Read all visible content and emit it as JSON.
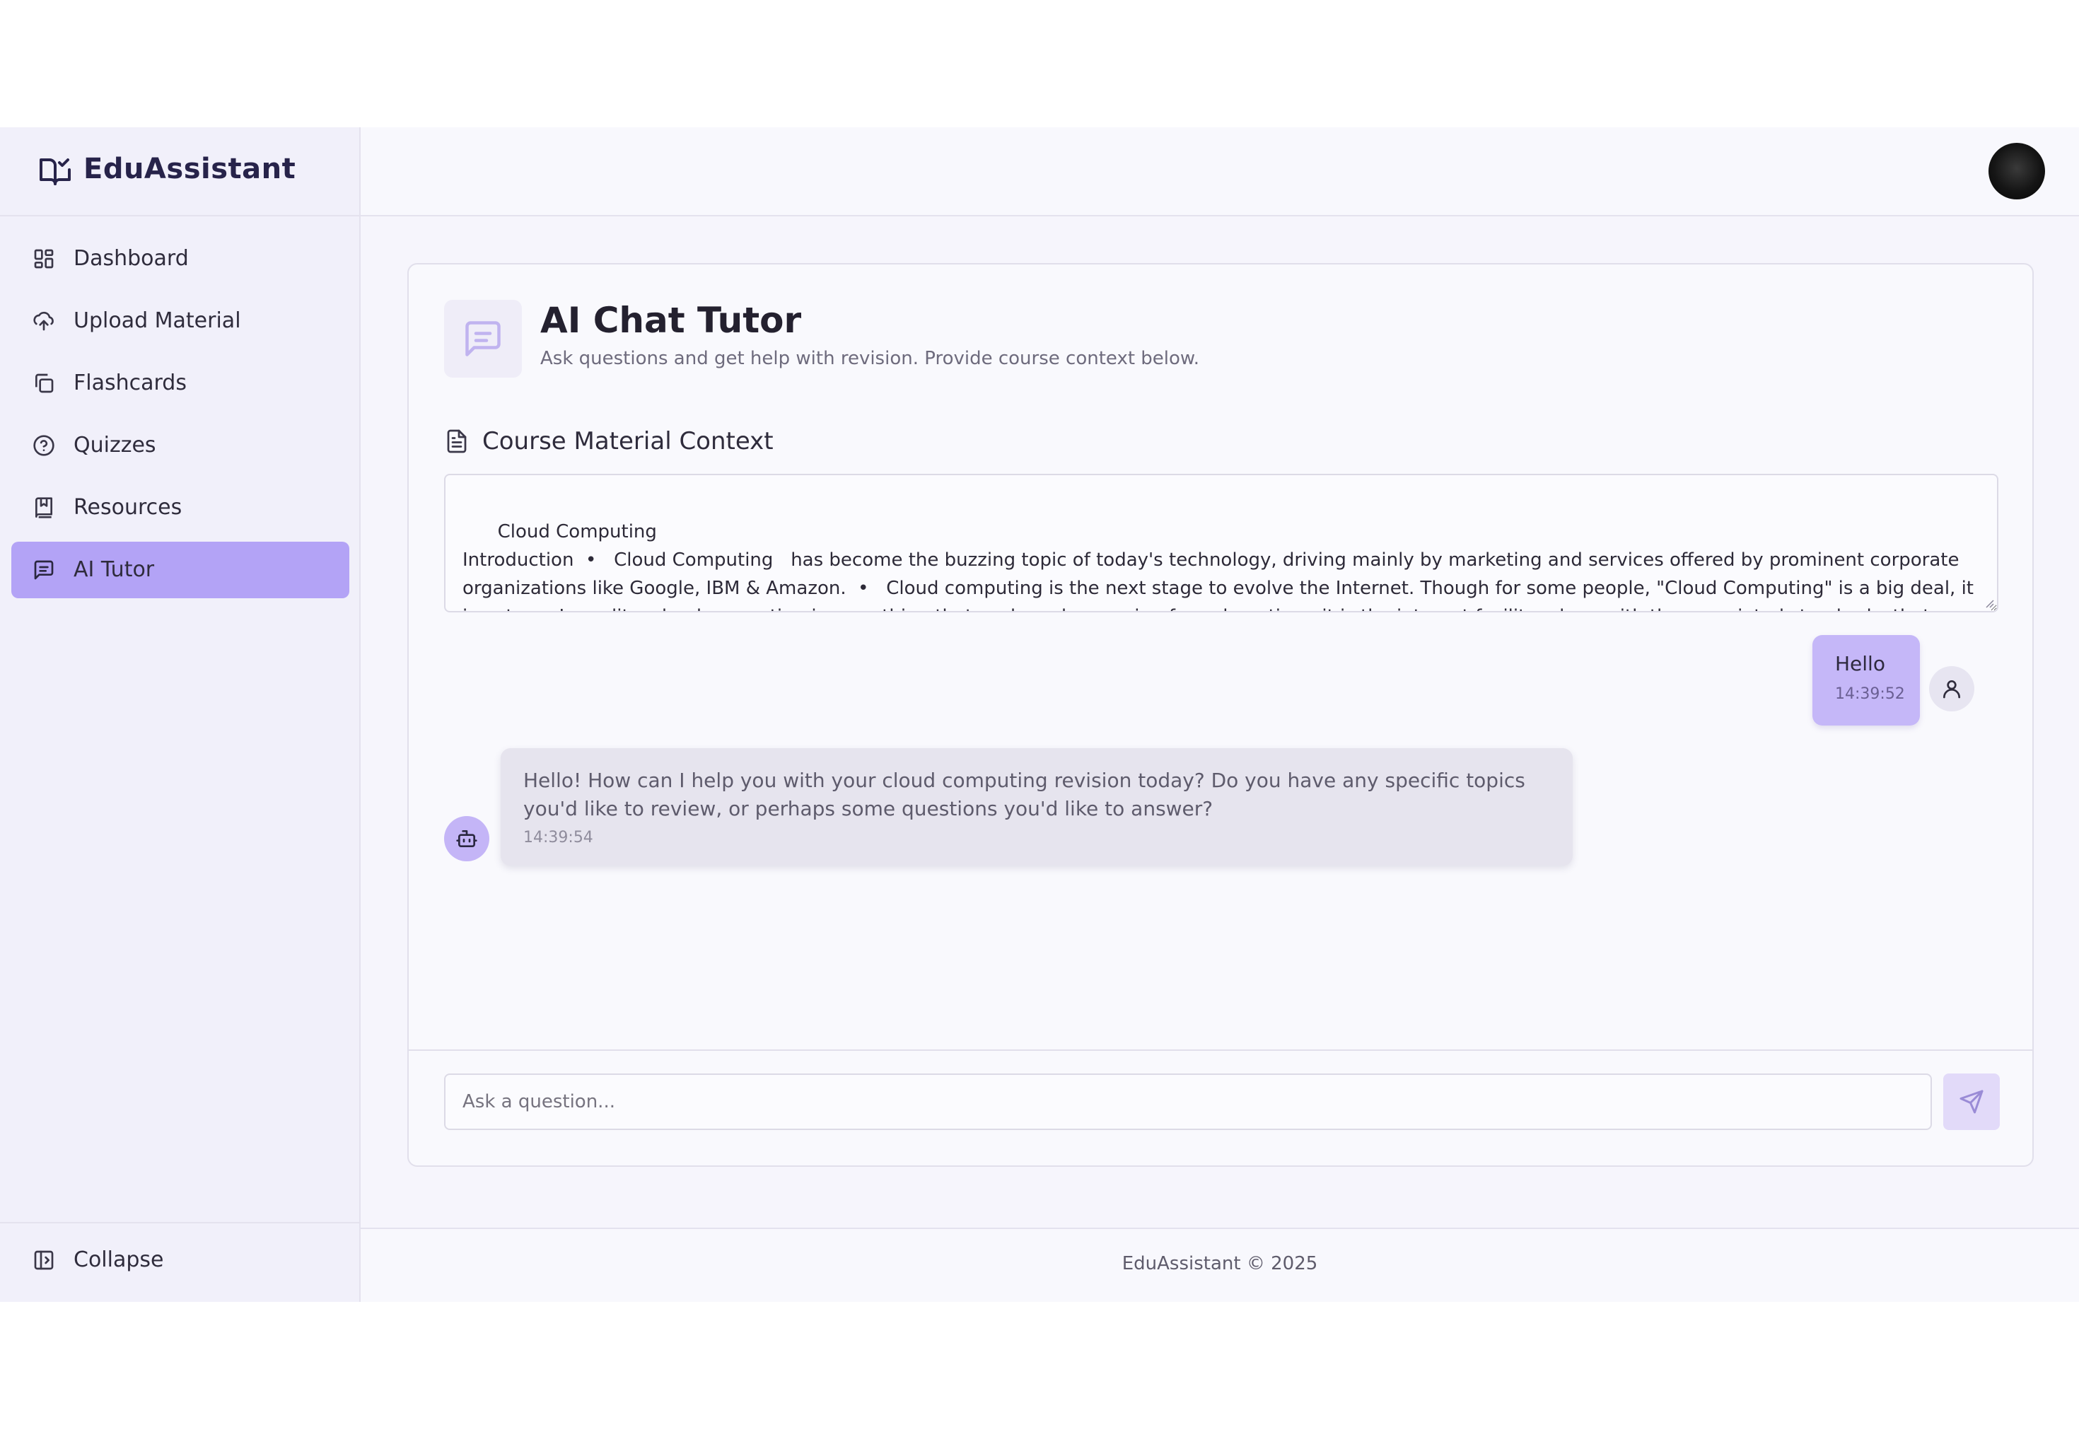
{
  "app": {
    "name": "EduAssistant"
  },
  "sidebar": {
    "items": [
      {
        "label": "Dashboard",
        "icon": "dashboard-icon"
      },
      {
        "label": "Upload Material",
        "icon": "upload-cloud-icon"
      },
      {
        "label": "Flashcards",
        "icon": "copy-icon"
      },
      {
        "label": "Quizzes",
        "icon": "help-circle-icon"
      },
      {
        "label": "Resources",
        "icon": "bookmark-book-icon"
      },
      {
        "label": "AI Tutor",
        "icon": "chat-icon",
        "active": true
      }
    ],
    "collapse_label": "Collapse"
  },
  "page": {
    "title": "AI Chat Tutor",
    "subtitle": "Ask questions and get help with revision. Provide course context below."
  },
  "context": {
    "label": "Course Material Context",
    "value": "Cloud Computing\nIntroduction  •   Cloud Computing   has become the buzzing topic of today's technology, driving mainly by marketing and services offered by prominent corporate  organizations like Google, IBM & Amazon.  •   Cloud computing is the next stage to evolve the Internet. Though for some people, \"Cloud Computing\" is a big deal, it is not.  •   In reality, cloud computing is something that we have been using for a  long time; it is the internet facility, along with the associated standards  that provide a set of web-services to users.  •   When we replace the term \"cloud\" with the essential characteristics of cloud computing - https://www.w3schools.in/cloud-computing"
  },
  "messages": [
    {
      "role": "user",
      "text": "Hello",
      "time": "14:39:52"
    },
    {
      "role": "assistant",
      "text": "Hello! How can I help you with your cloud computing revision today? Do you have any specific topics you'd like to review, or perhaps some questions you'd like to answer?",
      "time": "14:39:54"
    }
  ],
  "input": {
    "placeholder": "Ask a question...",
    "value": ""
  },
  "footer": {
    "text": "EduAssistant © 2025"
  },
  "colors": {
    "accent": "#b3a3f6",
    "user_bubble": "#c5b7f8",
    "bot_bubble": "#e6e4ee",
    "sidebar_bg": "#f1f0fa",
    "send_button": "#e2daf9"
  }
}
